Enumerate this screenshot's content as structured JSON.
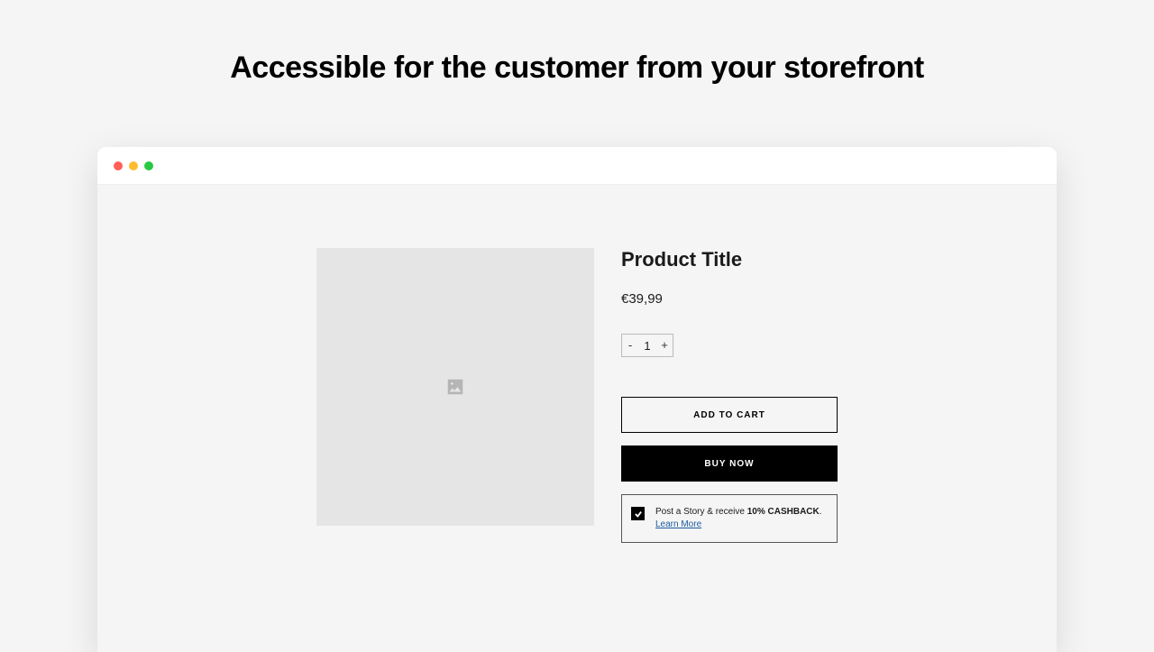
{
  "heading": "Accessible for the customer from your storefront",
  "product": {
    "title": "Product Title",
    "price": "€39,99",
    "quantity": "1",
    "qty_minus": "-",
    "qty_plus": "+",
    "add_to_cart": "ADD TO CART",
    "buy_now": "BUY NOW"
  },
  "cashback": {
    "prefix": "Post a Story & receive ",
    "highlight": "10% CASHBACK",
    "suffix": ".",
    "learn_more": "Learn More"
  }
}
